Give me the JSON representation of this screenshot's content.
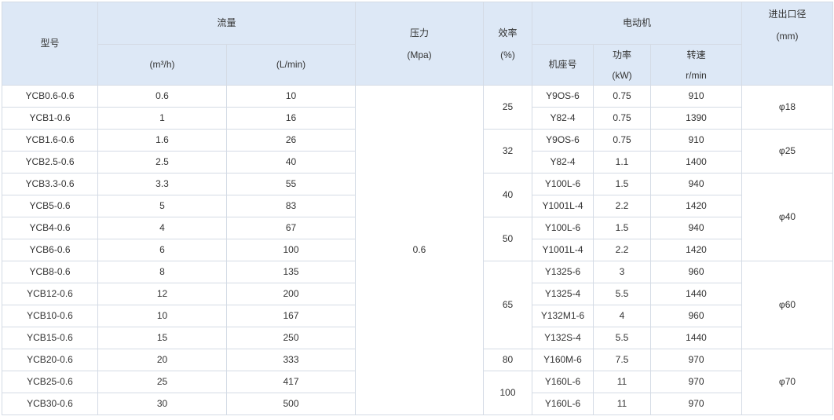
{
  "headers": {
    "model": "型号",
    "flow": "流量",
    "flow_m3h": "(m³/h)",
    "flow_lmin": "(L/min)",
    "pressure": "压力",
    "pressure_unit": "(Mpa)",
    "efficiency": "效率",
    "efficiency_unit": "(%)",
    "motor": "电动机",
    "motor_frame": "机座号",
    "motor_power": "功率",
    "motor_power_unit": "(kW)",
    "motor_speed": "转速",
    "motor_speed_unit": "r/min",
    "diameter": "进出口径",
    "diameter_unit": "(mm)"
  },
  "pressure_value": "0.6",
  "efficiency_groups": [
    "25",
    "32",
    "40",
    "50",
    "65",
    "80",
    "100"
  ],
  "diameter_groups": [
    "φ18",
    "φ25",
    "φ40",
    "φ60",
    "φ70"
  ],
  "rows": [
    {
      "model": "YCB0.6-0.6",
      "m3h": "0.6",
      "lmin": "10",
      "frame": "Y9OS-6",
      "power": "0.75",
      "speed": "910"
    },
    {
      "model": "YCB1-0.6",
      "m3h": "1",
      "lmin": "16",
      "frame": "Y82-4",
      "power": "0.75",
      "speed": "1390"
    },
    {
      "model": "YCB1.6-0.6",
      "m3h": "1.6",
      "lmin": "26",
      "frame": "Y9OS-6",
      "power": "0.75",
      "speed": "910"
    },
    {
      "model": "YCB2.5-0.6",
      "m3h": "2.5",
      "lmin": "40",
      "frame": "Y82-4",
      "power": "1.1",
      "speed": "1400"
    },
    {
      "model": "YCB3.3-0.6",
      "m3h": "3.3",
      "lmin": "55",
      "frame": "Y100L-6",
      "power": "1.5",
      "speed": "940"
    },
    {
      "model": "YCB5-0.6",
      "m3h": "5",
      "lmin": "83",
      "frame": "Y1001L-4",
      "power": "2.2",
      "speed": "1420"
    },
    {
      "model": "YCB4-0.6",
      "m3h": "4",
      "lmin": "67",
      "frame": "Y100L-6",
      "power": "1.5",
      "speed": "940"
    },
    {
      "model": "YCB6-0.6",
      "m3h": "6",
      "lmin": "100",
      "frame": "Y1001L-4",
      "power": "2.2",
      "speed": "1420"
    },
    {
      "model": "YCB8-0.6",
      "m3h": "8",
      "lmin": "135",
      "frame": "Y1325-6",
      "power": "3",
      "speed": "960"
    },
    {
      "model": "YCB12-0.6",
      "m3h": "12",
      "lmin": "200",
      "frame": "Y1325-4",
      "power": "5.5",
      "speed": "1440"
    },
    {
      "model": "YCB10-0.6",
      "m3h": "10",
      "lmin": "167",
      "frame": "Y132M1-6",
      "power": "4",
      "speed": "960"
    },
    {
      "model": "YCB15-0.6",
      "m3h": "15",
      "lmin": "250",
      "frame": "Y132S-4",
      "power": "5.5",
      "speed": "1440"
    },
    {
      "model": "YCB20-0.6",
      "m3h": "20",
      "lmin": "333",
      "frame": "Y160M-6",
      "power": "7.5",
      "speed": "970"
    },
    {
      "model": "YCB25-0.6",
      "m3h": "25",
      "lmin": "417",
      "frame": "Y160L-6",
      "power": "11",
      "speed": "970"
    },
    {
      "model": "YCB30-0.6",
      "m3h": "30",
      "lmin": "500",
      "frame": "Y160L-6",
      "power": "11",
      "speed": "970"
    }
  ]
}
